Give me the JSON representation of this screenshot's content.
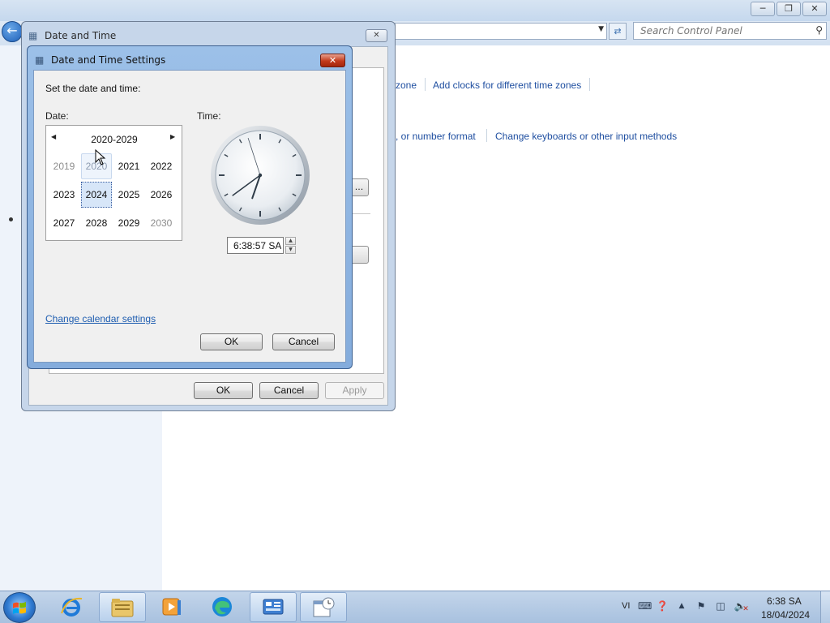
{
  "control_panel": {
    "search_placeholder": "Search Control Panel",
    "links": {
      "time_zone_partial": "zone",
      "add_clocks": "Add clocks for different time zones",
      "number_format_partial": ", or number format",
      "change_keyboards": "Change keyboards or other input methods"
    }
  },
  "date_time_dialog": {
    "title": "Date and Time",
    "button_partial": "...",
    "ok_label": "OK",
    "cancel_label": "Cancel",
    "apply_label": "Apply"
  },
  "settings_dialog": {
    "title": "Date and Time Settings",
    "instruction": "Set the date and time:",
    "date_label": "Date:",
    "time_label": "Time:",
    "calendar": {
      "decade_header": "2020-2029",
      "years": [
        "2019",
        "2020",
        "2021",
        "2022",
        "2023",
        "2024",
        "2025",
        "2026",
        "2027",
        "2028",
        "2029",
        "2030"
      ],
      "selected_year": "2024"
    },
    "clock": {
      "hours": 6,
      "minutes": 38,
      "seconds": 57
    },
    "time_value": "6:38:57 SA",
    "change_calendar_link": "Change calendar settings",
    "ok_label": "OK",
    "cancel_label": "Cancel"
  },
  "taskbar": {
    "apps": [
      "start-menu",
      "internet-explorer",
      "file-explorer",
      "media-player",
      "microsoft-edge",
      "control-panel",
      "date-time-settings"
    ],
    "language": "VI",
    "clock_time": "6:38 SA",
    "clock_date": "18/04/2024"
  }
}
